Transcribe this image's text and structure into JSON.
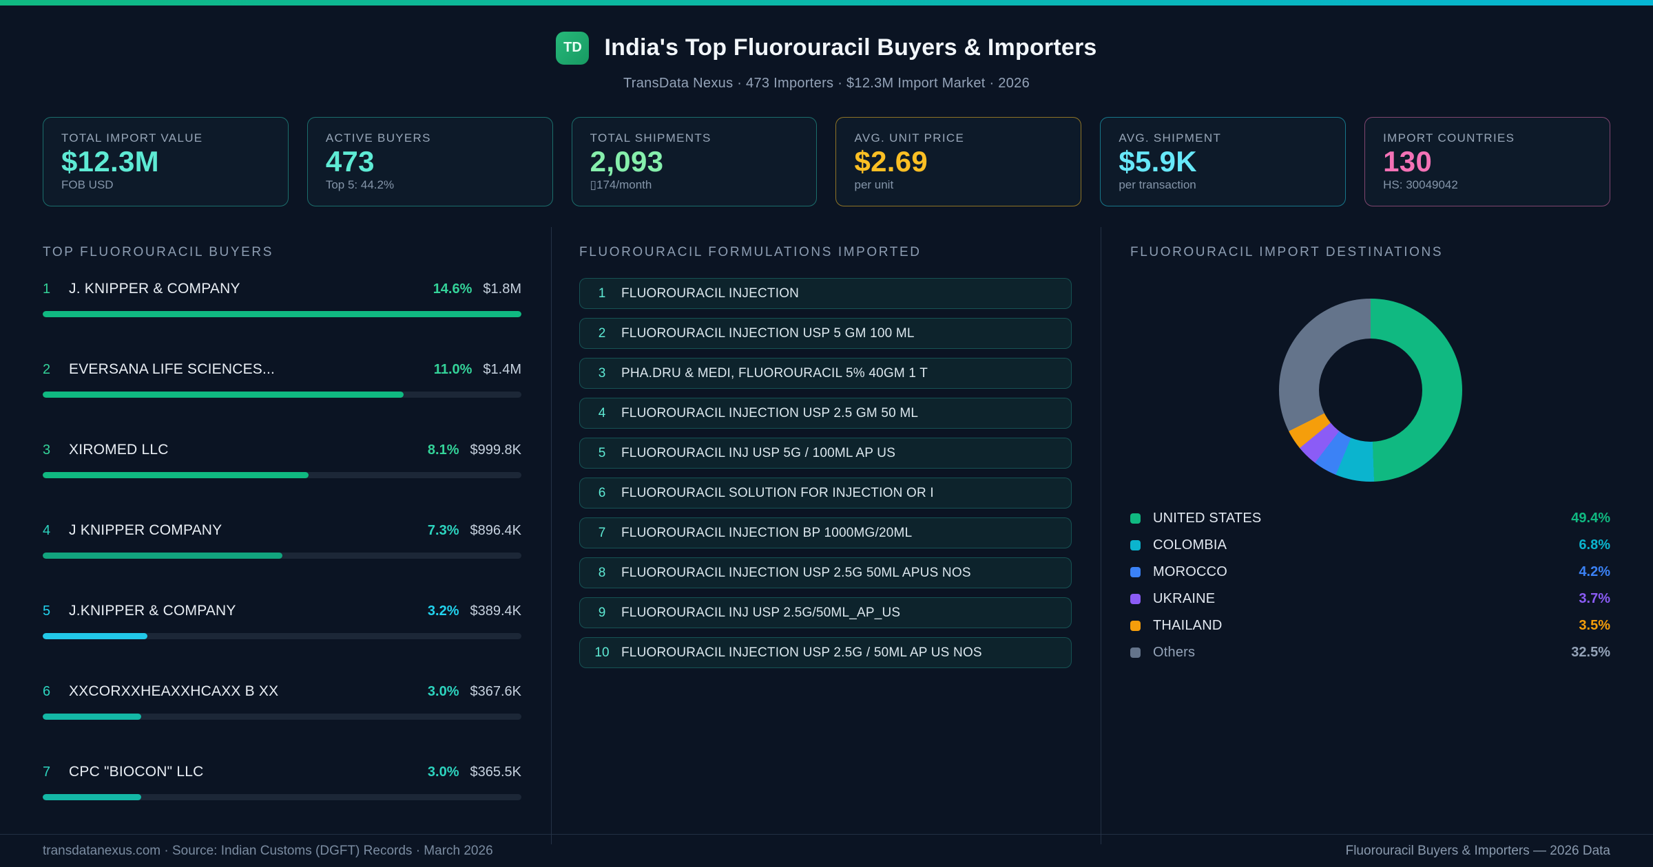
{
  "page": {
    "bg": "#0b1423",
    "accent_gradient": [
      "#10b981",
      "#06b6d4"
    ]
  },
  "header": {
    "logo": "TD",
    "title": "India's Top Fluorouracil Buyers & Importers",
    "subtitle": "TransData Nexus · 473 Importers · $12.3M Import Market · 2026"
  },
  "stats": [
    {
      "label": "TOTAL IMPORT VALUE",
      "value": "$12.3M",
      "sub": "FOB USD",
      "color": "#5eead4",
      "border": "rgba(45,212,191,0.45)"
    },
    {
      "label": "ACTIVE BUYERS",
      "value": "473",
      "sub": "Top 5: 44.2%",
      "color": "#5eead4",
      "border": "rgba(45,212,191,0.45)"
    },
    {
      "label": "TOTAL SHIPMENTS",
      "value": "2,093",
      "sub": "▯174/month",
      "color": "#86efac",
      "border": "rgba(45,212,191,0.45)"
    },
    {
      "label": "AVG. UNIT PRICE",
      "value": "$2.69",
      "sub": "per unit",
      "color": "#fbbf24",
      "border": "rgba(251,191,36,0.55)"
    },
    {
      "label": "AVG. SHIPMENT",
      "value": "$5.9K",
      "sub": "per transaction",
      "color": "#67e8f9",
      "border": "rgba(34,211,238,0.5)"
    },
    {
      "label": "IMPORT COUNTRIES",
      "value": "130",
      "sub": "HS: 30049042",
      "color": "#f472b6",
      "border": "rgba(244,114,182,0.5)"
    }
  ],
  "sections": {
    "buyers_title": "TOP FLUOROURACIL BUYERS",
    "formulations_title": "FLUOROURACIL FORMULATIONS IMPORTED",
    "destinations_title": "FLUOROURACIL IMPORT DESTINATIONS"
  },
  "chart_data": [
    {
      "type": "bar",
      "orientation": "horizontal",
      "title": "TOP FLUOROURACIL BUYERS",
      "unit": "% share of import value",
      "ranks": [
        "1",
        "2",
        "3",
        "4",
        "5",
        "6",
        "7"
      ],
      "categories": [
        "J. KNIPPER & COMPANY",
        "EVERSANA LIFE SCIENCES...",
        "XIROMED LLC",
        "J KNIPPER COMPANY",
        "J.KNIPPER & COMPANY",
        "XXCORXXHEAXXHCAXX B XX",
        "CPC \"BIOCON\" LLC"
      ],
      "values": [
        14.6,
        11.0,
        8.1,
        7.3,
        3.2,
        3.0,
        3.0
      ],
      "pct_labels": [
        "14.6%",
        "11.0%",
        "8.1%",
        "7.3%",
        "3.2%",
        "3.0%",
        "3.0%"
      ],
      "value_labels": [
        "$1.8M",
        "$1.4M",
        "$999.8K",
        "$896.4K",
        "$389.4K",
        "$367.6K",
        "$365.5K"
      ],
      "bar_colors": [
        "#10b981",
        "#10b981",
        "#10b981",
        "#12a47e",
        "#22c8e8",
        "#14b8a6",
        "#14b8a6"
      ],
      "pct_colors": [
        "#34d399",
        "#34d399",
        "#34d399",
        "#2dd4bf",
        "#22d3ee",
        "#2dd4bf",
        "#2dd4bf"
      ],
      "xlim": [
        0,
        14.6
      ],
      "track_color": "#1c2737"
    },
    {
      "type": "pie",
      "subtype": "donut",
      "title": "FLUOROURACIL IMPORT DESTINATIONS",
      "labels": [
        "UNITED STATES",
        "COLOMBIA",
        "MOROCCO",
        "UKRAINE",
        "THAILAND",
        "Others"
      ],
      "values": [
        49.4,
        6.8,
        4.2,
        3.7,
        3.5,
        32.5
      ],
      "value_labels": [
        "49.4%",
        "6.8%",
        "4.2%",
        "3.7%",
        "3.5%",
        "32.5%"
      ],
      "colors": [
        "#10b981",
        "#0bb4ce",
        "#3b82f6",
        "#8b5cf6",
        "#f59e0b",
        "#64748b"
      ],
      "others_text_color": "#94a3b8",
      "start_angle_deg": 0,
      "direction": "clockwise",
      "hole_ratio": 0.56,
      "legend_position": "bottom-list"
    }
  ],
  "formulations": [
    "FLUOROURACIL INJECTION",
    "FLUOROURACIL INJECTION USP 5 GM 100 ML",
    "PHA.DRU & MEDI, FLUOROURACIL 5% 40GM 1 T",
    "FLUOROURACIL INJECTION USP 2.5 GM 50 ML",
    "FLUOROURACIL INJ USP 5G / 100ML AP US",
    "FLUOROURACIL SOLUTION FOR INJECTION OR I",
    "FLUOROURACIL INJECTION BP 1000MG/20ML",
    "FLUOROURACIL INJECTION USP 2.5G 50ML APUS NOS",
    "FLUOROURACIL INJ USP 2.5G/50ML_AP_US",
    "FLUOROURACIL INJECTION USP 2.5G / 50ML AP US NOS"
  ],
  "formulation_ranks": [
    "1",
    "2",
    "3",
    "4",
    "5",
    "6",
    "7",
    "8",
    "9",
    "10"
  ],
  "footer": {
    "left": "transdatanexus.com · Source: Indian Customs (DGFT) Records · March 2026",
    "right": "Fluorouracil Buyers & Importers — 2026 Data"
  }
}
